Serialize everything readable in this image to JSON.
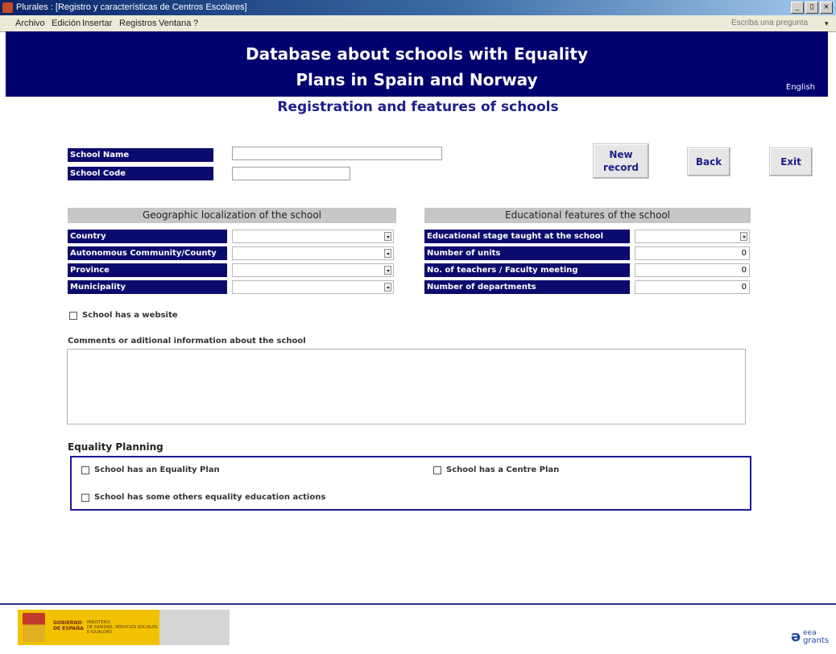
{
  "window": {
    "title": "Plurales : [Registro y características de Centros Escolares]",
    "buttons": [
      "_",
      "▯",
      "×"
    ]
  },
  "menu": {
    "items": [
      "Archivo",
      "Edición",
      "Insertar",
      "Registros",
      "Ventana",
      "?"
    ],
    "help_placeholder": "Escriba una pregunta",
    "help_arrow": "▾"
  },
  "header": {
    "title_line1": "Database about schools with Equality",
    "title_line2": "Plans in Spain and Norway",
    "language_link": "English"
  },
  "subtitle": "Registration and features of schools",
  "school": {
    "name_label": "School Name",
    "code_label": "School Code",
    "name_value": "",
    "code_value": ""
  },
  "buttons": {
    "new_record_line1": "New",
    "new_record_line2": "record",
    "back": "Back",
    "exit": "Exit"
  },
  "geo": {
    "heading": "Geographic localization of the school",
    "fields": [
      "Country",
      "Autonomous Community/County",
      "Province",
      "Municipality"
    ]
  },
  "edu": {
    "heading": "Educational features of the school",
    "fields": [
      "Educational stage taught at the school",
      "Number of units",
      "No. of teachers / Faculty meeting",
      "Number of departments"
    ],
    "values": [
      "",
      "0",
      "0",
      "0"
    ]
  },
  "website_checkbox": "School has a website",
  "comments_label": "Comments or aditional information about the school",
  "equality": {
    "heading": "Equality Planning",
    "has_plan": "School has an Equality Plan",
    "has_centre_plan": "School has a Centre Plan",
    "other_actions": "School has some others equality education actions"
  },
  "footer": {
    "gov_text_1": "GOBIERNO",
    "gov_text_2": "DE ESPAÑA",
    "ministry_1": "MINISTERIO",
    "ministry_2": "DE SANIDAD, SERVICIOS SOCIALES",
    "ministry_3": "E IGUALDAD",
    "eea_1": "eea",
    "eea_2": "grants"
  }
}
